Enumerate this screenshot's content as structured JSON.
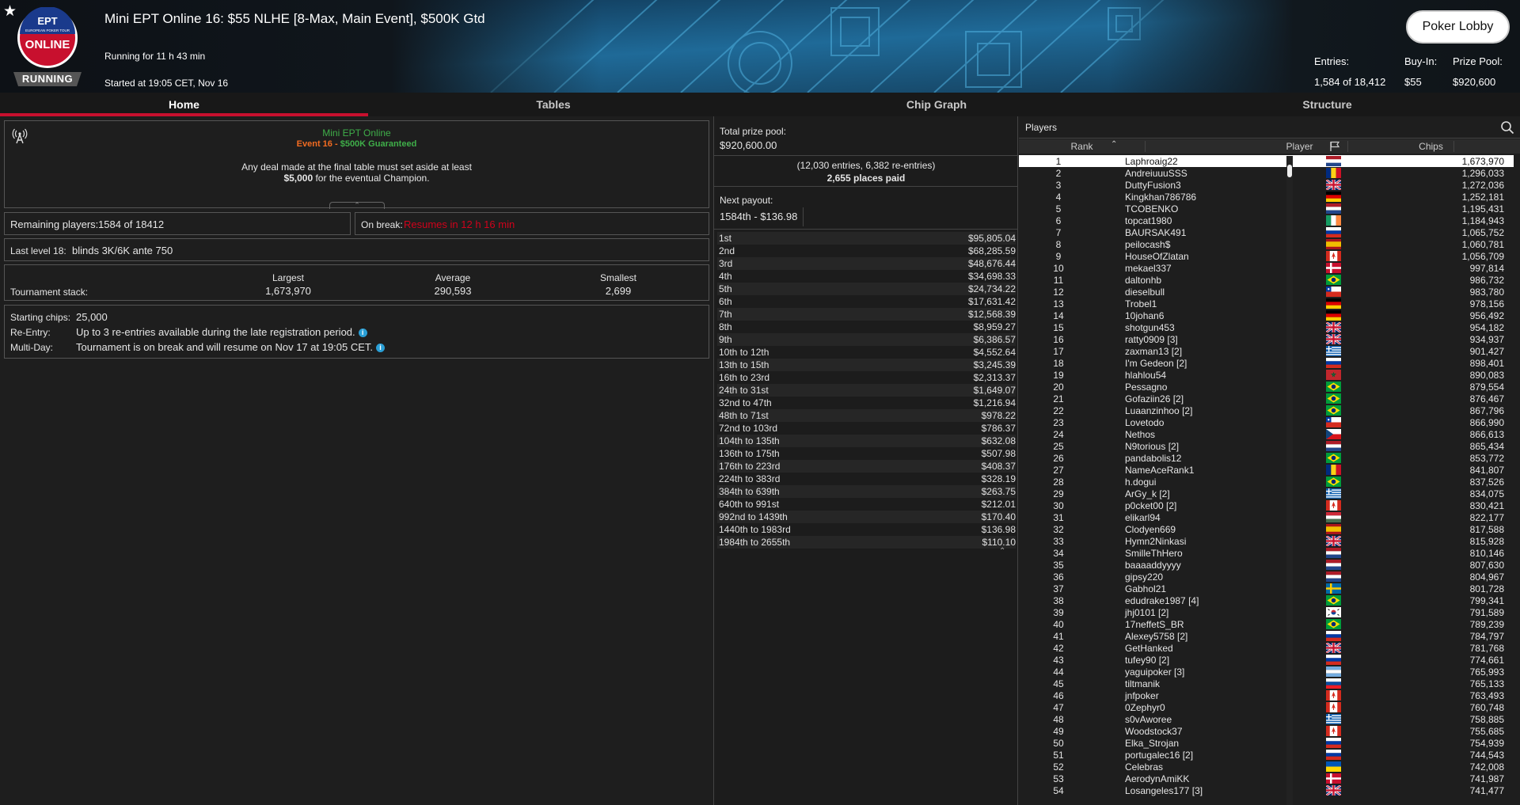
{
  "header": {
    "status": "RUNNING",
    "title": "Mini EPT Online 16: $55 NLHE [8-Max, Main Event], $500K Gtd",
    "running_for": "Running for 11 h 43 min",
    "started_at": "Started at 19:05 CET, Nov 16",
    "lobby_button": "Poker Lobby",
    "logo": {
      "top": "EPT",
      "sub": "EUROPEAN POKER TOUR",
      "main": "ONLINE"
    },
    "stats": [
      {
        "label": "Entries:",
        "value": "1,584 of 18,412"
      },
      {
        "label": "Buy-In:",
        "value": "$55"
      },
      {
        "label": "Prize Pool:",
        "value": "$920,600"
      }
    ]
  },
  "tabs": [
    {
      "label": "Home"
    },
    {
      "label": "Tables"
    },
    {
      "label": "Chip Graph"
    },
    {
      "label": "Structure"
    }
  ],
  "home": {
    "brand": "Mini EPT Online",
    "event": "Event 16",
    "sep": " - ",
    "guarantee": "$500K Guaranteed",
    "deal_line1": "Any deal made at the final table must set aside at least",
    "deal_amount": "$5,000",
    "deal_line2": " for the eventual Champion.",
    "remaining_label": "Remaining players:",
    "remaining_value": "1584 of 18412",
    "break_label": "On break:",
    "break_value": "Resumes in 12 h 16 min",
    "level_label": "Last level 18:",
    "level_value": "blinds 3K/6K ante 750",
    "stack_label": "Tournament stack:",
    "stack": [
      {
        "label": "Largest",
        "value": "1,673,970"
      },
      {
        "label": "Average",
        "value": "290,593"
      },
      {
        "label": "Smallest",
        "value": "2,699"
      }
    ],
    "starting_label": "Starting chips:",
    "starting_value": "25,000",
    "reentry_label": "Re-Entry:",
    "reentry_value": "Up to 3 re-entries available during the late registration period.",
    "multiday_label": "Multi-Day:",
    "multiday_value": "Tournament is on break and will resume on Nov 17 at 19:05 CET."
  },
  "prize": {
    "total_label": "Total prize pool:",
    "total_value": "$920,600.00",
    "entries_note": "(12,030 entries, 6,382 re-entries)",
    "places_paid": "2,655 places paid",
    "next_label": "Next payout:",
    "next_value": "1584th - $136.98",
    "payouts": [
      [
        "1st",
        "$95,805.04"
      ],
      [
        "2nd",
        "$68,285.59"
      ],
      [
        "3rd",
        "$48,676.44"
      ],
      [
        "4th",
        "$34,698.33"
      ],
      [
        "5th",
        "$24,734.22"
      ],
      [
        "6th",
        "$17,631.42"
      ],
      [
        "7th",
        "$12,568.39"
      ],
      [
        "8th",
        "$8,959.27"
      ],
      [
        "9th",
        "$6,386.57"
      ],
      [
        "10th to 12th",
        "$4,552.64"
      ],
      [
        "13th to 15th",
        "$3,245.39"
      ],
      [
        "16th to 23rd",
        "$2,313.37"
      ],
      [
        "24th to 31st",
        "$1,649.07"
      ],
      [
        "32nd to 47th",
        "$1,216.94"
      ],
      [
        "48th to 71st",
        "$978.22"
      ],
      [
        "72nd to 103rd",
        "$786.37"
      ],
      [
        "104th to 135th",
        "$632.08"
      ],
      [
        "136th to 175th",
        "$507.98"
      ],
      [
        "176th to 223rd",
        "$408.37"
      ],
      [
        "224th to 383rd",
        "$328.19"
      ],
      [
        "384th to 639th",
        "$263.75"
      ],
      [
        "640th to 991st",
        "$212.01"
      ],
      [
        "992nd to 1439th",
        "$170.40"
      ],
      [
        "1440th to 1983rd",
        "$136.98"
      ],
      [
        "1984th to 2655th",
        "$110.10"
      ]
    ]
  },
  "players": {
    "title": "Players",
    "columns": {
      "rank": "Rank",
      "player": "Player",
      "chips": "Chips"
    },
    "rows": [
      [
        1,
        "Laphroaig22",
        "1,673,970",
        "nl"
      ],
      [
        2,
        "AndreiuuuSSS",
        "1,296,033",
        "ro"
      ],
      [
        3,
        "DuttyFusion3",
        "1,272,036",
        "gb"
      ],
      [
        4,
        "Kingkhan786786",
        "1,252,181",
        "de"
      ],
      [
        5,
        "TCOBENKO",
        "1,195,431",
        "nl"
      ],
      [
        6,
        "topcat1980",
        "1,184,943",
        "ie"
      ],
      [
        7,
        "BAURSAK491",
        "1,065,752",
        "ru"
      ],
      [
        8,
        "peilocash$",
        "1,060,781",
        "es"
      ],
      [
        9,
        "HouseOfZlatan",
        "1,056,709",
        "ca"
      ],
      [
        10,
        "mekael337",
        "997,814",
        "dk"
      ],
      [
        11,
        "daltonhb",
        "986,732",
        "br"
      ],
      [
        12,
        "dieselbull",
        "983,780",
        "cl"
      ],
      [
        13,
        "Trobel1",
        "978,156",
        "de"
      ],
      [
        14,
        "10johan6",
        "956,492",
        "de"
      ],
      [
        15,
        "shotgun453",
        "954,182",
        "gb"
      ],
      [
        16,
        "ratty0909 [3]",
        "934,937",
        "gb"
      ],
      [
        17,
        "zaxman13 [2]",
        "901,427",
        "gr"
      ],
      [
        18,
        "I'm Gedeon [2]",
        "898,401",
        "ru"
      ],
      [
        19,
        "hlahlou54",
        "890,083",
        "ma"
      ],
      [
        20,
        "Pessagno",
        "879,554",
        "br"
      ],
      [
        21,
        "Gofaziin26 [2]",
        "876,467",
        "br"
      ],
      [
        22,
        "Luaanzinhoo [2]",
        "867,796",
        "br"
      ],
      [
        23,
        "Lovetodo",
        "866,990",
        "cl"
      ],
      [
        24,
        "Nethos",
        "866,613",
        "cz"
      ],
      [
        25,
        "N9torious [2]",
        "865,434",
        "nl"
      ],
      [
        26,
        "pandabolis12",
        "853,772",
        "br"
      ],
      [
        27,
        "NameAceRank1",
        "841,807",
        "ro"
      ],
      [
        28,
        "h.dogui",
        "837,526",
        "br"
      ],
      [
        29,
        "ArGy_k [2]",
        "834,075",
        "gr"
      ],
      [
        30,
        "p0cket00 [2]",
        "830,421",
        "ca"
      ],
      [
        31,
        "elikarl94",
        "822,177",
        "hu"
      ],
      [
        32,
        "Clodyen669",
        "817,588",
        "es"
      ],
      [
        33,
        "Hymn2Ninkasi",
        "815,928",
        "gb"
      ],
      [
        34,
        "SmilleThHero",
        "810,146",
        "nl"
      ],
      [
        35,
        "baaaaddyyyy",
        "807,630",
        "nl"
      ],
      [
        36,
        "gipsy220",
        "804,967",
        "nl"
      ],
      [
        37,
        "Gabhol21",
        "801,728",
        "se"
      ],
      [
        38,
        "edudrake1987 [4]",
        "799,341",
        "br"
      ],
      [
        39,
        "jhj0101 [2]",
        "791,589",
        "kr"
      ],
      [
        40,
        "17neffetS_BR",
        "789,239",
        "br"
      ],
      [
        41,
        "Alexey5758 [2]",
        "784,797",
        "ru"
      ],
      [
        42,
        "GetHanked",
        "781,768",
        "gb"
      ],
      [
        43,
        "tufey90 [2]",
        "774,661",
        "ru"
      ],
      [
        44,
        "yaguipoker [3]",
        "765,993",
        "ar"
      ],
      [
        45,
        "tiltmanik",
        "765,133",
        "sk"
      ],
      [
        46,
        "jnfpoker",
        "763,493",
        "ca"
      ],
      [
        47,
        "0Zephyr0",
        "760,748",
        "ca"
      ],
      [
        48,
        "s0vAworee",
        "758,885",
        "gr"
      ],
      [
        49,
        "Woodstock37",
        "755,685",
        "ca"
      ],
      [
        50,
        "Elka_Strojan",
        "754,939",
        "ru"
      ],
      [
        51,
        "portugalec16 [2]",
        "744,543",
        "ru"
      ],
      [
        52,
        "Celebras",
        "742,008",
        "ua"
      ],
      [
        53,
        "AerodynAmiKK",
        "741,987",
        "dk"
      ],
      [
        54,
        "Losangeles177 [3]",
        "741,477",
        "gb"
      ]
    ]
  },
  "colors": {
    "accent": "#c8102e",
    "brand_green": "#3fae49",
    "event_orange": "#f26b21",
    "break_red": "#d0021b"
  }
}
